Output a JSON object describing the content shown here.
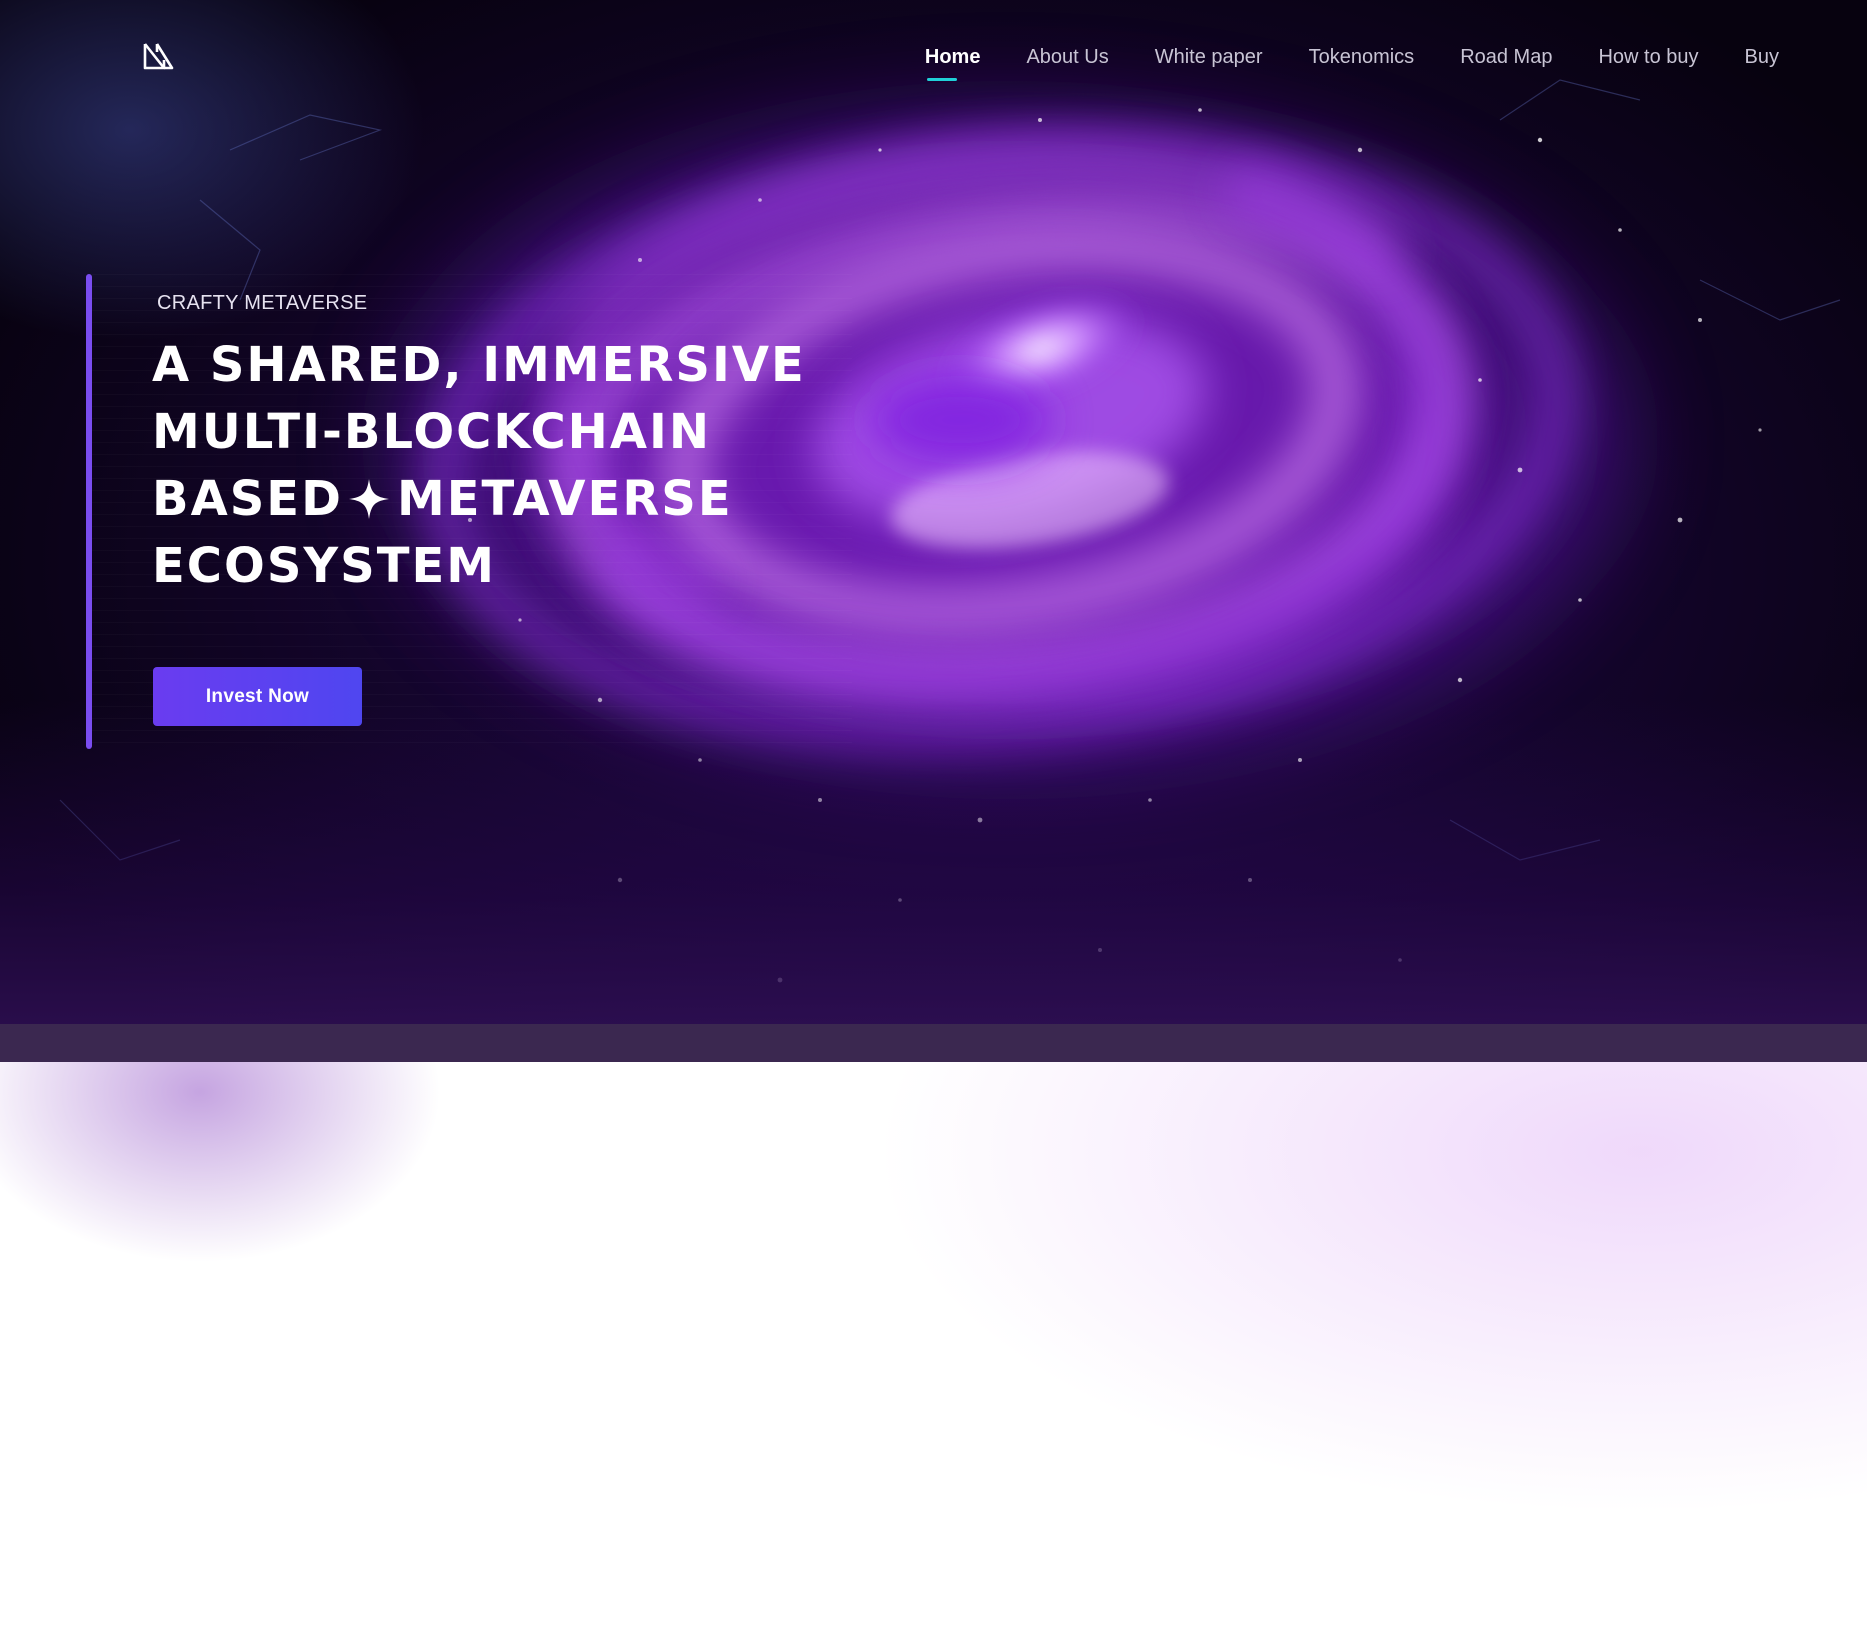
{
  "brand": {
    "logo_icon": "crafty-logo-icon",
    "accent_color": "#7a4df0",
    "active_underline_color": "#20d0d8"
  },
  "nav": {
    "items": [
      {
        "label": "Home",
        "active": true
      },
      {
        "label": "About Us",
        "active": false
      },
      {
        "label": "White paper",
        "active": false
      },
      {
        "label": "Tokenomics",
        "active": false
      },
      {
        "label": "Road Map",
        "active": false
      },
      {
        "label": "How to buy",
        "active": false
      },
      {
        "label": "Buy",
        "active": false
      }
    ]
  },
  "hero": {
    "eyebrow": "CRAFTY METAVERSE",
    "headline": {
      "line1": "A SHARED, IMMERSIVE",
      "line2": "MULTI-BLOCKCHAIN",
      "line3a": "BASED",
      "line3b": "METAVERSE",
      "line4": "ECOSYSTEM"
    },
    "sparkle_icon": "sparkle-icon",
    "cta_label": "Invest Now",
    "background": "purple spiral galaxy"
  }
}
